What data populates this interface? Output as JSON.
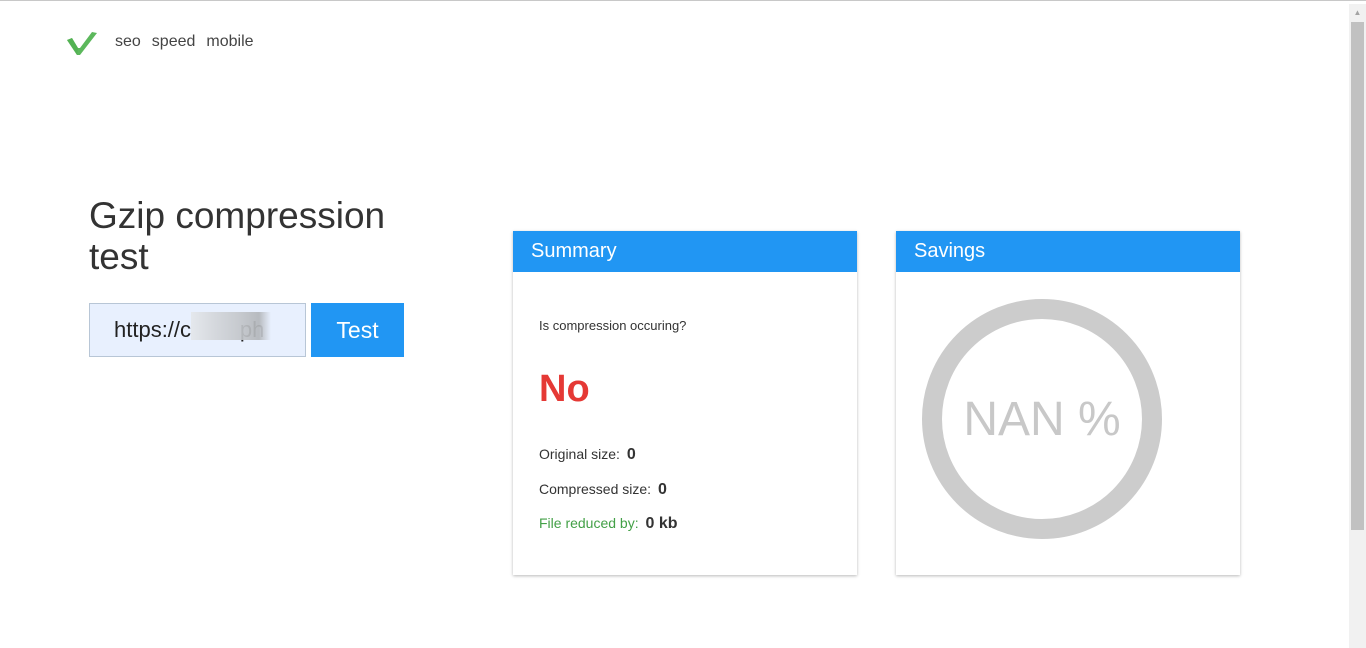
{
  "header": {
    "logo_icon": "checkmark-logo-icon",
    "nav": [
      "seo",
      "speed",
      "mobile"
    ]
  },
  "main": {
    "title": "Gzip compression test",
    "url_input_value": "https://c        ph",
    "test_button_label": "Test"
  },
  "summary": {
    "header": "Summary",
    "question": "Is compression occuring?",
    "answer": "No",
    "original_label": "Original size:",
    "original_value": "0",
    "compressed_label": "Compressed size:",
    "compressed_value": "0",
    "reduced_label": "File reduced by:",
    "reduced_value": "0 kb"
  },
  "savings": {
    "header": "Savings",
    "percent_text": "NAN %"
  },
  "colors": {
    "accent": "#2196f3",
    "answer_no": "#e53935",
    "reduced_label": "#43a047",
    "ring": "#cccccc",
    "logo": "#5cb85c"
  }
}
